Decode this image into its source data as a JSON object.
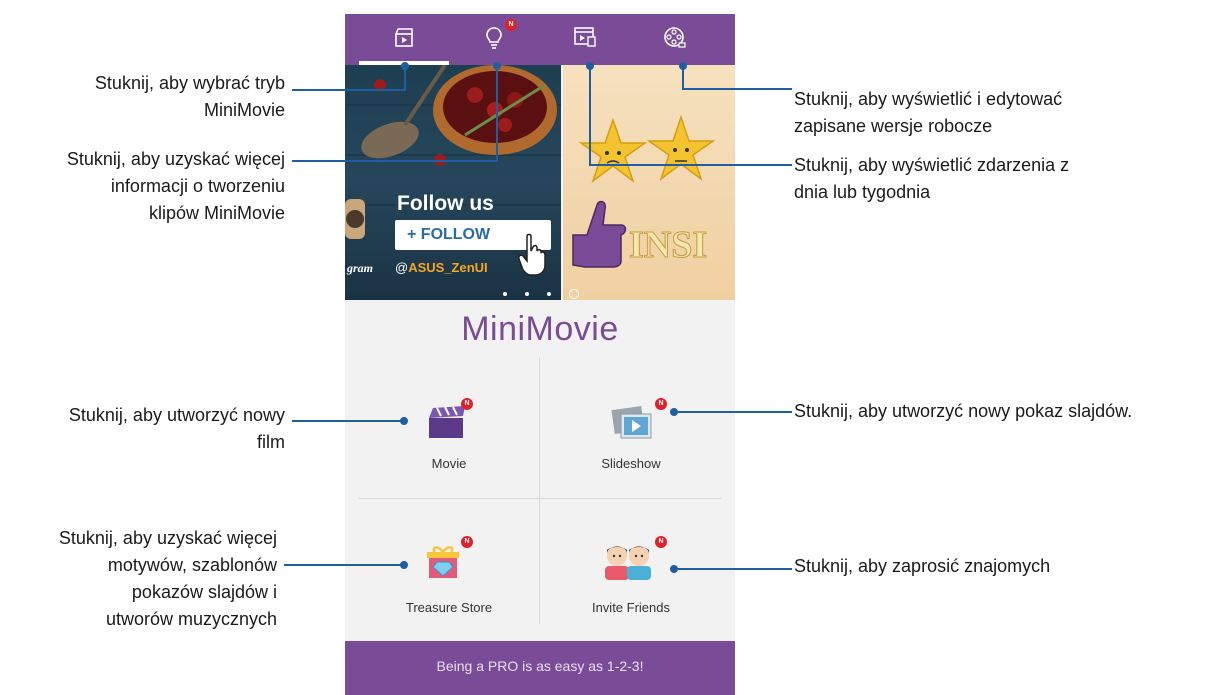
{
  "app": {
    "logo_text": "MiniMovie",
    "badge_letter": "N",
    "colors": {
      "primary": "#7a4c97",
      "badge": "#e0202a",
      "annotation_line": "#1f5fa1"
    }
  },
  "tabs": [
    {
      "name": "minimovie-mode",
      "icon": "clapperboard-icon"
    },
    {
      "name": "tips",
      "icon": "lightbulb-icon"
    },
    {
      "name": "events",
      "icon": "event-video-icon"
    },
    {
      "name": "drafts",
      "icon": "film-reel-icon"
    }
  ],
  "banner": {
    "follow_title": "Follow us",
    "follow_button": "+ FOLLOW",
    "instagram_fragment": "gram",
    "handle_at": "@",
    "handle_name": "ASUS_ZenUI",
    "slide2_text": "INSI"
  },
  "tiles": [
    {
      "label": "Movie",
      "icon": "clapperboard-icon"
    },
    {
      "label": "Slideshow",
      "icon": "slideshow-icon"
    },
    {
      "label": "Treasure Store",
      "icon": "gift-box-icon"
    },
    {
      "label": "Invite Friends",
      "icon": "friends-icon"
    }
  ],
  "pro_bar": "Being a PRO is as easy as 1-2-3!",
  "annotations": {
    "mode": [
      "Stuknij, aby wybrać tryb",
      "MiniMovie"
    ],
    "info": [
      "Stuknij, aby uzyskać więcej",
      "informacji o tworzeniu",
      "klipów MiniMovie"
    ],
    "movie": [
      "Stuknij, aby utworzyć nowy",
      "film"
    ],
    "store": [
      "Stuknij, aby uzyskać więcej",
      "motywów, szablonów",
      "pokazów slajdów i",
      "utworów muzycznych"
    ],
    "drafts": [
      "Stuknij, aby wyświetlić i edytować",
      "zapisane wersje robocze"
    ],
    "events": [
      "Stuknij, aby wyświetlić zdarzenia z",
      "dnia lub tygodnia"
    ],
    "slideshow": [
      "Stuknij, aby utworzyć nowy pokaz slajdów."
    ],
    "invite": [
      "Stuknij, aby zaprosić znajomych"
    ]
  }
}
